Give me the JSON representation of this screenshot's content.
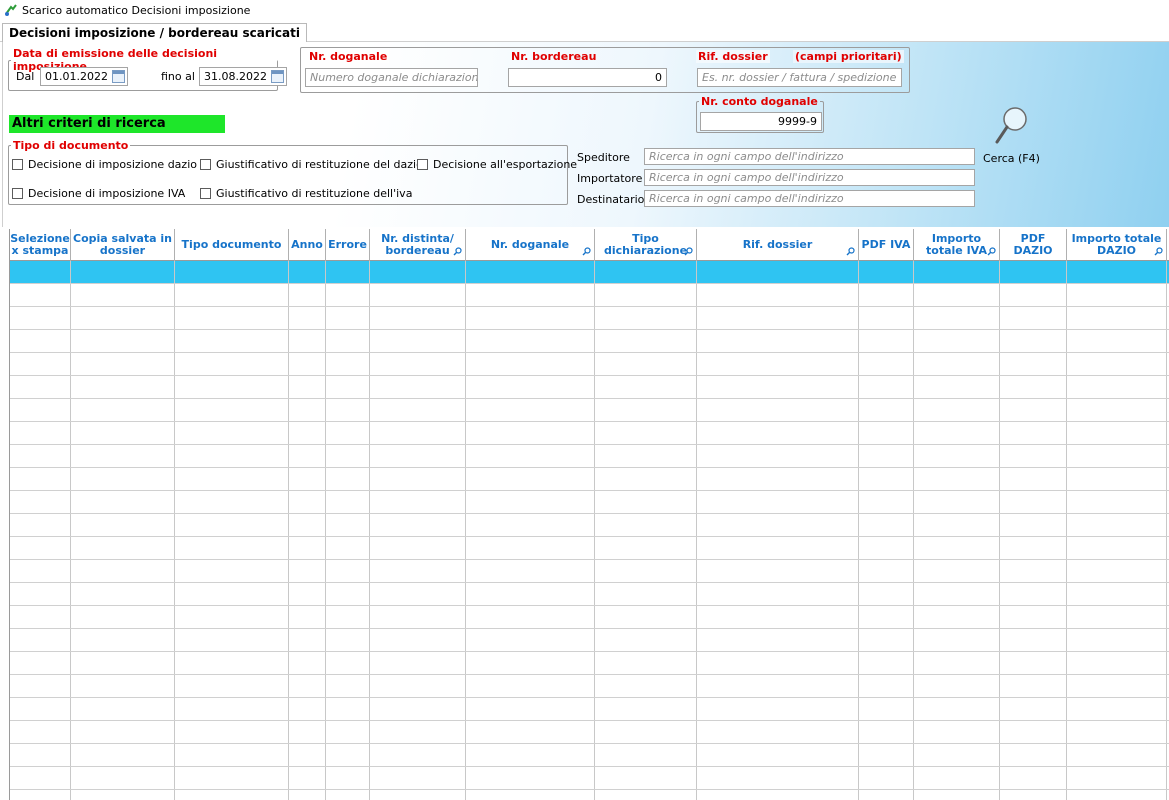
{
  "window": {
    "title": "Scarico automatico Decisioni imposizione"
  },
  "tabs": [
    {
      "label": "Decisioni imposizione / bordereau scaricati"
    }
  ],
  "filters": {
    "date_group": {
      "legend": "Data di emissione delle decisioni imposizione",
      "from_label": "Dal",
      "from_value": "01.01.2022",
      "to_label": "fino al",
      "to_value": "31.08.2022"
    },
    "nr_doganale": {
      "label": "Nr. doganale",
      "placeholder": "Numero doganale dichiarazione"
    },
    "nr_bordereau": {
      "label": "Nr. bordereau",
      "value": "0"
    },
    "rif_dossier": {
      "label": "Rif. dossier",
      "extra": "(campi prioritari)",
      "placeholder": "Es. nr. dossier / fattura / spedizione"
    },
    "nr_conto": {
      "label": "Nr. conto doganale",
      "value": "9999-9"
    },
    "altri_criteri": "Altri criteri di ricerca",
    "tipo_documento": {
      "legend": "Tipo di documento",
      "options": [
        "Decisione di imposizione dazio",
        "Giustificativo di restituzione del dazio",
        "Decisione all'esportazione",
        "Decisione di imposizione IVA",
        "Giustificativo di restituzione dell'iva"
      ]
    },
    "address": [
      {
        "label": "Speditore",
        "placeholder": "Ricerca in ogni campo dell'indirizzo"
      },
      {
        "label": "Importatore",
        "placeholder": "Ricerca in ogni campo dell'indirizzo"
      },
      {
        "label": "Destinatario",
        "placeholder": "Ricerca in ogni campo dell'indirizzo"
      }
    ],
    "search_button": "Cerca (F4)"
  },
  "grid": {
    "columns": [
      {
        "label": "Selezione x stampa",
        "filter": false
      },
      {
        "label": "Copia salvata in dossier",
        "filter": false
      },
      {
        "label": "Tipo documento",
        "filter": false
      },
      {
        "label": "Anno",
        "filter": false
      },
      {
        "label": "Errore",
        "filter": false
      },
      {
        "label": "Nr. distinta/ bordereau",
        "filter": true
      },
      {
        "label": "Nr. doganale",
        "filter": true
      },
      {
        "label": "Tipo dichiarazione",
        "filter": true
      },
      {
        "label": "Rif. dossier",
        "filter": true
      },
      {
        "label": "PDF IVA",
        "filter": false
      },
      {
        "label": "Importo totale IVA",
        "filter": true
      },
      {
        "label": "PDF DAZIO",
        "filter": false
      },
      {
        "label": "Importo totale DAZIO",
        "filter": true
      }
    ],
    "accent_color": "#2fc4f2",
    "header_color": "#1673c9"
  }
}
